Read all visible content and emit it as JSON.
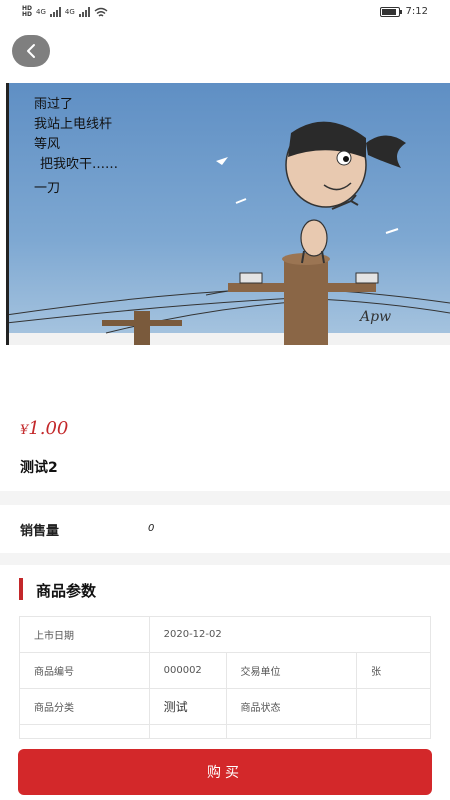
{
  "status_bar": {
    "hd1": "HD",
    "hd2": "HD",
    "net1": "4G",
    "net2": "4G",
    "time": "7:12"
  },
  "product": {
    "image_label": "一刀",
    "cartoon_text": [
      "雨过了",
      "我站上电线杆",
      "等风",
      "把我吹干……"
    ],
    "price_currency": "¥",
    "price_value": "1.00",
    "name": "测试2"
  },
  "sales": {
    "label": "销售量",
    "value": "0"
  },
  "params": {
    "title": "商品参数",
    "rows": [
      {
        "k1": "上市日期",
        "v1": "2020-12-02",
        "k2": "",
        "v2": ""
      },
      {
        "k1": "商品编号",
        "v1": "000002",
        "k2": "交易单位",
        "v2": "张"
      },
      {
        "k1": "商品分类",
        "v1": "测试",
        "k2": "商品状态",
        "v2": ""
      }
    ]
  },
  "actions": {
    "buy_label": "购买"
  },
  "colors": {
    "accent": "#d3282a",
    "price": "#c3282a"
  }
}
